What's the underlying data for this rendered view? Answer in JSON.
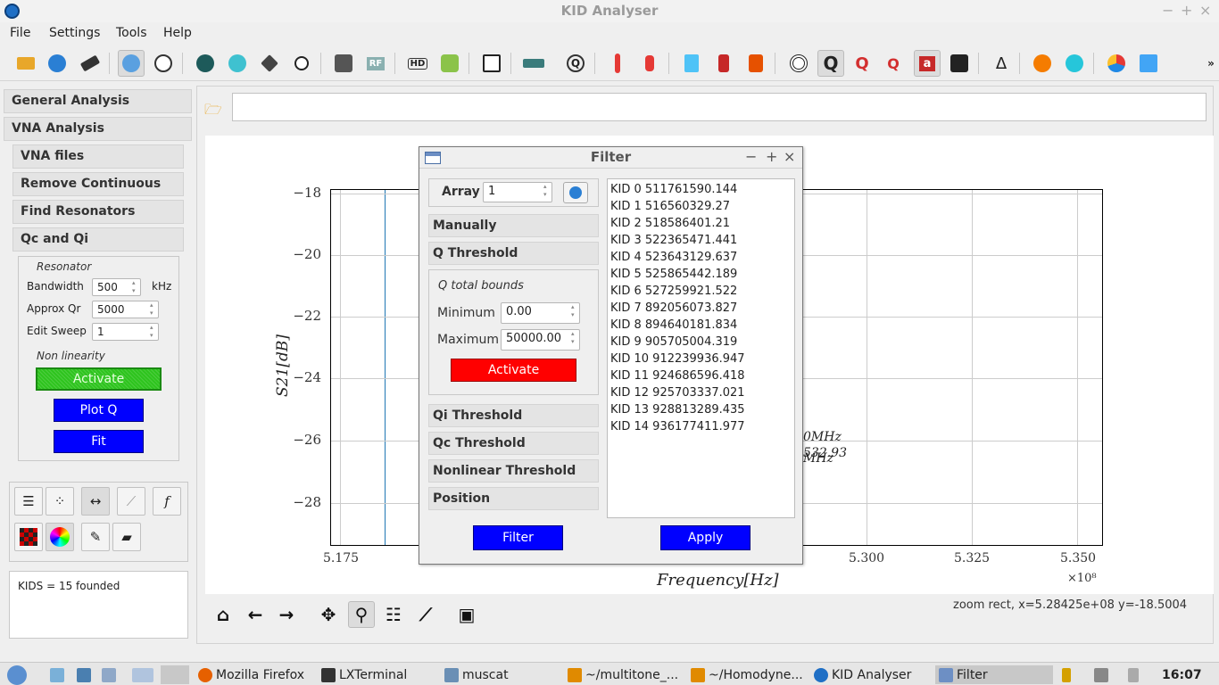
{
  "window": {
    "title": "KID Analyser",
    "minimize": "−",
    "maximize": "+",
    "close": "×"
  },
  "menu": [
    "File",
    "Settings",
    "Tools",
    "Help"
  ],
  "toolbar": {
    "rf_label": "RF",
    "hd_label": "HD",
    "q_label": "Q",
    "a_label": "a",
    "delta_label": "Δ",
    "more": "»"
  },
  "left": {
    "general_analysis": "General Analysis",
    "vna_analysis": "VNA Analysis",
    "vna_files": "VNA files",
    "remove_continuous": "Remove Continuous",
    "find_resonators": "Find Resonators",
    "qc_qi": "Qc and Qi",
    "resonator_title": "Resonator",
    "bandwidth_label": "Bandwidth",
    "bandwidth_value": "500",
    "bandwidth_unit": "kHz",
    "approx_qr_label": "Approx Qr",
    "approx_qr_value": "5000",
    "edit_sweep_label": "Edit Sweep",
    "edit_sweep_value": "1",
    "nonlinearity_title": "Non linearity",
    "activate": "Activate",
    "plot_q": "Plot Q",
    "fit": "Fit",
    "status_text": "KIDS = 15 founded",
    "f_icon": "f"
  },
  "plot": {
    "ylabel": "S21[dB]",
    "xlabel": "Frequency[Hz]",
    "x_multiplier": "×10⁸",
    "yticks": [
      "−18",
      "−20",
      "−22",
      "−24",
      "−26",
      "−28"
    ],
    "xticks": [
      "5.175",
      "5.300",
      "5.325",
      "5.350"
    ],
    "annotation1": "0MHz",
    "annotation2": "532.93",
    "annotation3": "MHz",
    "status": "zoom rect, x=5.28425e+08  y=-18.5004"
  },
  "dialog": {
    "title": "Filter",
    "array_label": "Array",
    "array_value": "1",
    "manually": "Manually",
    "q_threshold": "Q Threshold",
    "q_bounds_title": "Q total bounds",
    "min_label": "Minimum",
    "min_value": "0.00",
    "max_label": "Maximum",
    "max_value": "50000.00",
    "activate": "Activate",
    "qi_threshold": "Qi Threshold",
    "qc_threshold": "Qc Threshold",
    "nonlinear_threshold": "Nonlinear Threshold",
    "position": "Position",
    "filter_btn": "Filter",
    "apply_btn": "Apply",
    "kids": [
      "KID 0 511761590.144",
      "KID 1 516560329.27",
      "KID 2 518586401.21",
      "KID 3 522365471.441",
      "KID 4 523643129.637",
      "KID 5 525865442.189",
      "KID 6 527259921.522",
      "KID 7 892056073.827",
      "KID 8 894640181.834",
      "KID 9 905705004.319",
      "KID 10 912239936.947",
      "KID 11 924686596.418",
      "KID 12 925703337.021",
      "KID 13 928813289.435",
      "KID 14 936177411.977"
    ]
  },
  "taskbar": {
    "firefox": "Mozilla Firefox",
    "lxterminal": "LXTerminal",
    "muscat": "muscat",
    "multitone": "~/multitone_...",
    "homodyne": "~/Homodyne...",
    "kid_analyser": "KID Analyser",
    "filter": "Filter",
    "clock": "16:07"
  }
}
